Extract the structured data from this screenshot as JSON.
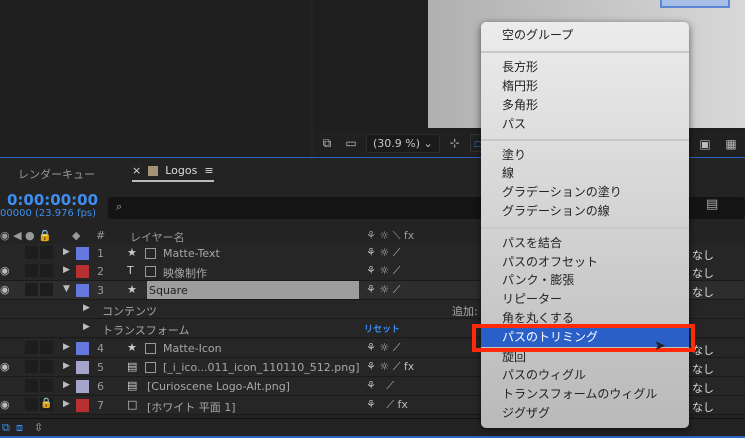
{
  "viewer": {
    "zoom": "(30.9 %)",
    "zoom_chevron": "⌄"
  },
  "tabs": {
    "render_queue": "レンダーキュー",
    "close": "×",
    "comp": "Logos",
    "menu": "≡"
  },
  "timecode": "0:00:00:00",
  "fps": "00000 (23.976 fps)",
  "search": {
    "icon": "⌕"
  },
  "columns": {
    "num": "#",
    "layer_name": "レイヤー名",
    "switches": "⚘ ☼ ⟍ fx"
  },
  "layers": [
    {
      "num": "1",
      "name": "Matte-Text",
      "color": "#6478e0",
      "type": "★",
      "parent": "なし"
    },
    {
      "num": "2",
      "name": "映像制作",
      "color": "#b83030",
      "type": "T",
      "parent": "なし"
    },
    {
      "num": "3",
      "name": "Square",
      "color": "#6478e0",
      "type": "★",
      "parent": "なし"
    },
    {
      "num": "4",
      "name": "Matte-Icon",
      "color": "#6478e0",
      "type": "★",
      "parent": "なし"
    },
    {
      "num": "5",
      "name": "[_i_ico...011_icon_110110_512.png]",
      "color": "#a4a4cc",
      "type": "▤",
      "parent": "なし"
    },
    {
      "num": "6",
      "name": "[Curioscene Logo-Alt.png]",
      "color": "#a4a4cc",
      "type": "▤",
      "parent": "なし"
    },
    {
      "num": "7",
      "name": "[ホワイト 平面 1]",
      "color": "#b83030",
      "type": "□",
      "parent": "なし"
    }
  ],
  "sub": {
    "contents": "コンテンツ",
    "add": "追加:",
    "transform": "トランスフォーム",
    "reset": "リセット"
  },
  "menu": {
    "groups": [
      [
        "空のグループ"
      ],
      [
        "長方形",
        "楕円形",
        "多角形",
        "パス"
      ],
      [
        "塗り",
        "線",
        "グラデーションの塗り",
        "グラデーションの線"
      ],
      [
        "パスを結合",
        "パスのオフセット",
        "パンク・膨張",
        "リピーター",
        "角を丸くする",
        "パスのトリミング",
        "旋回",
        "パスのウィグル",
        "トランスフォームのウィグル",
        "ジグザグ"
      ]
    ],
    "highlighted": "パスのトリミング"
  },
  "colors": {
    "accent": "#3d8ef0",
    "highlight": "#2a5fc8",
    "annotation": "#ff2a0a"
  }
}
